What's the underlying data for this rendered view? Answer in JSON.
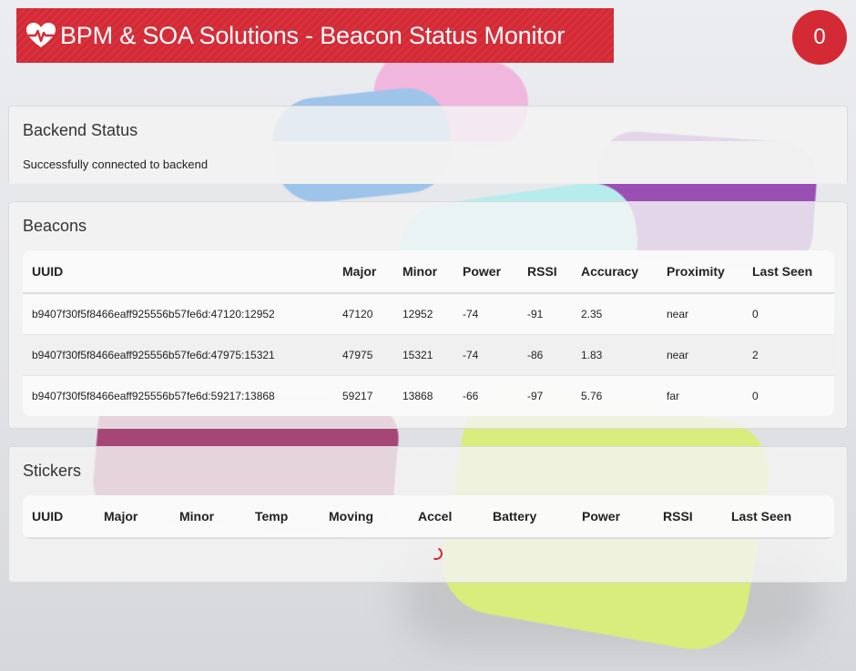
{
  "header": {
    "title": "BPM & SOA Solutions - Beacon Status Monitor",
    "icon": "heartbeat-icon",
    "badge_count": "0",
    "accent_color": "#d42a36"
  },
  "backend_status": {
    "title": "Backend Status",
    "message": "Successfully connected to backend"
  },
  "beacons": {
    "title": "Beacons",
    "columns": [
      "UUID",
      "Major",
      "Minor",
      "Power",
      "RSSI",
      "Accuracy",
      "Proximity",
      "Last Seen"
    ],
    "rows": [
      [
        "b9407f30f5f8466eaff925556b57fe6d:47120:12952",
        "47120",
        "12952",
        "-74",
        "-91",
        "2.35",
        "near",
        "0"
      ],
      [
        "b9407f30f5f8466eaff925556b57fe6d:47975:15321",
        "47975",
        "15321",
        "-74",
        "-86",
        "1.83",
        "near",
        "2"
      ],
      [
        "b9407f30f5f8466eaff925556b57fe6d:59217:13868",
        "59217",
        "13868",
        "-66",
        "-97",
        "5.76",
        "far",
        "0"
      ]
    ]
  },
  "stickers": {
    "title": "Stickers",
    "columns": [
      "UUID",
      "Major",
      "Minor",
      "Temp",
      "Moving",
      "Accel",
      "Battery",
      "Power",
      "RSSI",
      "Last Seen"
    ],
    "rows": [],
    "loading_icon": "spinner-icon"
  }
}
